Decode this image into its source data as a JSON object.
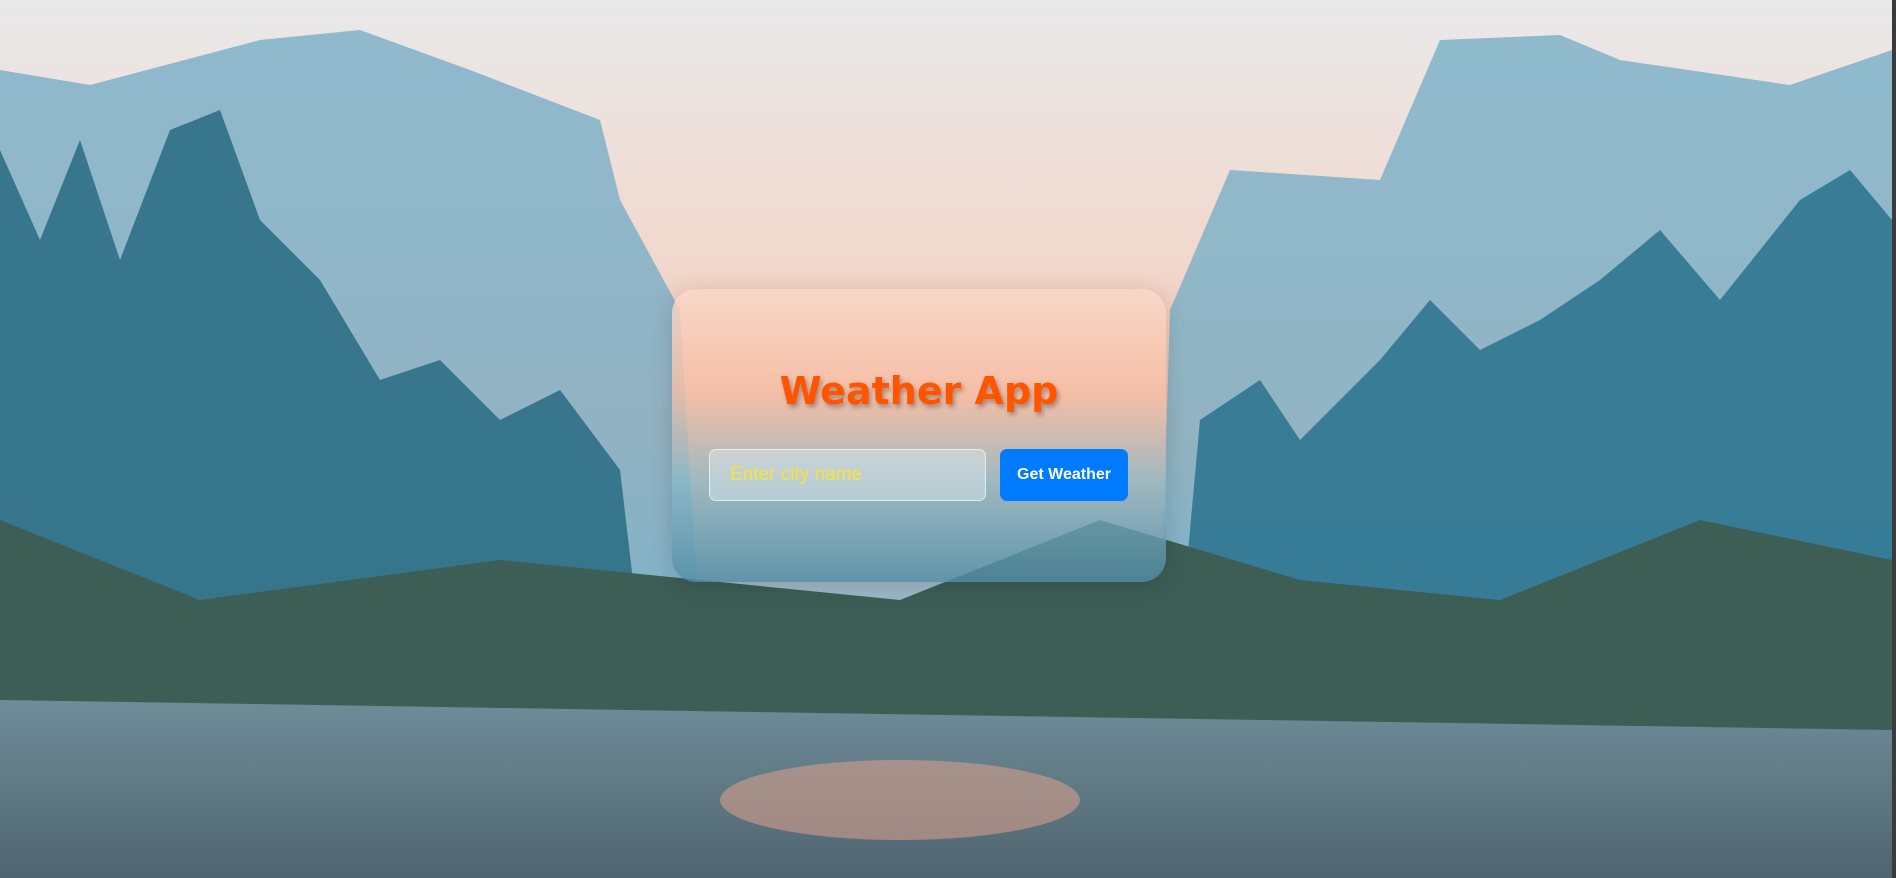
{
  "app": {
    "title": "Weather App",
    "city_input": {
      "placeholder": "Enter city name",
      "value": ""
    },
    "get_weather_label": "Get Weather"
  },
  "colors": {
    "title": "#ff5500",
    "button": "#007bff",
    "placeholder": "#f5e53a"
  }
}
